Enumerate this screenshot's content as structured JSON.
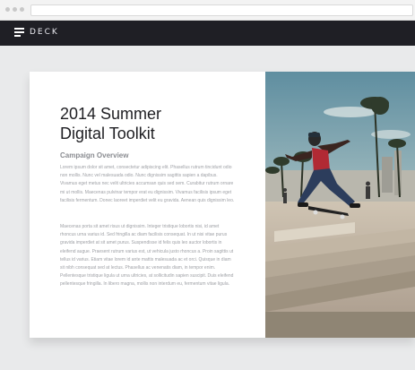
{
  "app": {
    "brand": "DECK"
  },
  "slide": {
    "title": "2014 Summer\nDigital Toolkit",
    "subtitle": "Campaign Overview",
    "paragraphs": [
      "Lorem ipsum dolor sit amet, consectetur adipiscing elit. Phasellus rutrum tincidunt odio non mollis. Nunc vel malesuada odio. Nunc dignissim sagittis sapien a dapibus. Vivamus eget metus nec velit ultricies accumsan quis sed sem. Curabitur rutrum ornare mi ut mollis. Maecenas pulvinar tempor erat eu dignissim. Vivamus facilisis ipsum eget facilisis fermentum. Donec laoreet imperdiet velit eu gravida. Aenean quis dignissim leo.",
      "Maecenas porta sit amet risus ut dignissim. Integer tristique lobortis nisi, id amet rhoncus urna varius id. Sed fringilla ac diam facilisis consequat. In ut nisi vitae purus gravida imperdiet at sit amet purus. Suspendisse id felis quis leo auctor lobortis in eleifend augue. Praesent rutrum varius est, ut vehicula justo rhoncus a. Proin sagittis ut tellus id varius. Etiam vitae lorem id ante mattis malesuada ac et orci. Quisque in diam sit nibh consequat sed at lectus. Phasellus ac venenatis diam, in tempor enim. Pellentesque tristique ligula ut urna ultricies, at sollicitudin sapien suscipit. Duis eleifend pellentesque fringilla. In libero magna, mollis non interdum eu, fermentum vitae ligula."
    ]
  },
  "colors": {
    "appbar": "#1f1f25",
    "stage": "#e9eaeb",
    "title": "#1e1e22",
    "body_text": "#9fa1a6"
  },
  "icons": {
    "menu": "hamburger-icon"
  }
}
